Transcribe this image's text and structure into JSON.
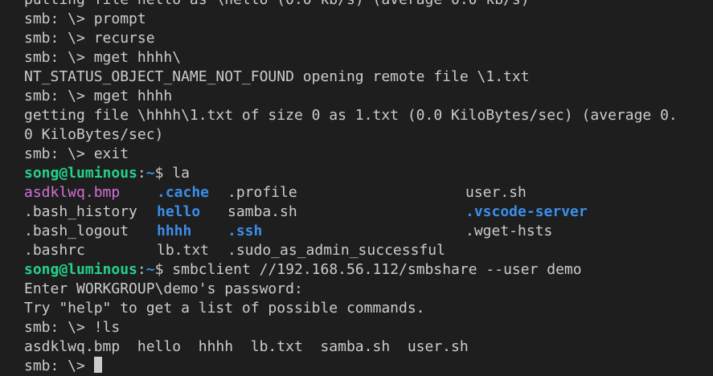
{
  "terminal": {
    "lines_top": [
      "putting file hello as \\hello (0.0 kb/s) (average 0.0 kb/s)",
      "smb: \\> prompt",
      "smb: \\> recurse",
      "smb: \\> mget hhhh\\",
      "NT_STATUS_OBJECT_NAME_NOT_FOUND opening remote file \\1.txt",
      "smb: \\> mget hhhh",
      "getting file \\hhhh\\1.txt of size 0 as 1.txt (0.0 KiloBytes/sec) (average 0.",
      "0 KiloBytes/sec)",
      "smb: \\> exit"
    ],
    "prompt_user": "song@luminous",
    "prompt_sep": ":",
    "prompt_path": "~",
    "prompt_symbol": "$ ",
    "command_la": "la",
    "ls_rows": [
      [
        "asdklwq.bmp",
        ".cache",
        ".profile",
        "user.sh"
      ],
      [
        ".bash_history",
        "hello",
        "samba.sh",
        ".vscode-server"
      ],
      [
        ".bash_logout",
        "hhhh",
        ".ssh",
        ".wget-hsts"
      ],
      [
        ".bashrc",
        "lb.txt",
        ".sudo_as_admin_successful",
        ""
      ]
    ],
    "command_smbclient": "smbclient //192.168.56.112/smbshare --user demo",
    "lines_bottom": [
      "Enter WORKGROUP\\demo's password:",
      "Try \"help\" to get a list of possible commands.",
      "smb: \\> !ls",
      "asdklwq.bmp  hello  hhhh  lb.txt  samba.sh  user.sh"
    ],
    "last_prompt": "smb: \\> "
  },
  "colors": {
    "background": "#1e1e1e",
    "text": "#cccccc",
    "prompt_user": "#23d18b",
    "prompt_path": "#3b8eea",
    "directory": "#3b8eea",
    "image_file": "#d670d6"
  }
}
